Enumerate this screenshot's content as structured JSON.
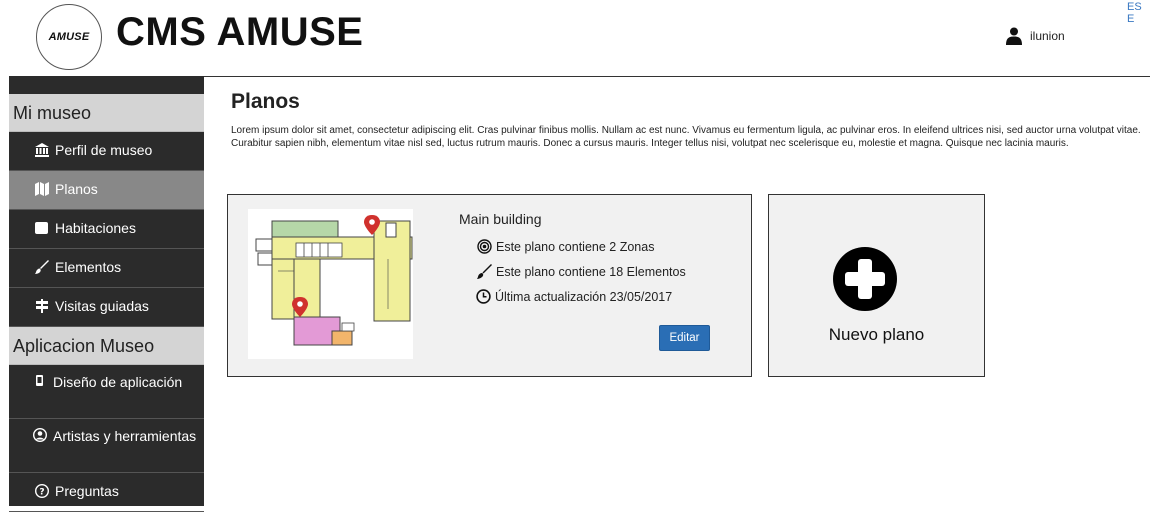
{
  "header": {
    "logo_text": "AMUSE",
    "brand": "CMS AMUSE",
    "lang": "ES E",
    "user_name": "ilunion"
  },
  "sidebar": {
    "sections": [
      {
        "title": "Mi museo",
        "items": [
          {
            "label": "Perfil de museo",
            "icon": "museum-icon",
            "active": false
          },
          {
            "label": "Planos",
            "icon": "map-icon",
            "active": true
          },
          {
            "label": "Habitaciones",
            "icon": "square-icon",
            "active": false
          },
          {
            "label": "Elementos",
            "icon": "brush-icon",
            "active": false
          },
          {
            "label": "Visitas guiadas",
            "icon": "signpost-icon",
            "active": false
          }
        ]
      },
      {
        "title": "Aplicacion Museo",
        "items": [
          {
            "label": "Diseño de aplicación",
            "icon": "phone-icon",
            "active": false
          },
          {
            "label": "Artistas y herramientas",
            "icon": "user-circle-icon",
            "active": false
          },
          {
            "label": "Preguntas",
            "icon": "question-circle-icon",
            "active": false
          }
        ]
      }
    ]
  },
  "main": {
    "title": "Planos",
    "description": "Lorem ipsum dolor sit amet, consectetur adipiscing elit. Cras pulvinar finibus mollis. Nullam ac est nunc. Vivamus eu fermentum ligula, ac pulvinar eros. In eleifend ultrices nisi, sed auctor urna volutpat vitae. Curabitur sapien nibh, elementum vitae nisl sed, luctus rutrum mauris. Donec a cursus mauris. Integer tellus nisi, volutpat nec scelerisque eu, molestie et magna. Quisque nec lacinia mauris.",
    "plan_card": {
      "name": "Main building",
      "zones": "Este plano contiene 2 Zonas",
      "elements": "Este plano contiene 18 Elementos",
      "updated": "Última actualización 23/05/2017",
      "edit_label": "Editar"
    },
    "new_plan_label": "Nuevo plano"
  },
  "colors": {
    "sidebar_bg": "#2b2b2b",
    "section_bg": "#d4d4d4",
    "active_item_bg": "#888888",
    "button_blue": "#2a6eb5",
    "link_blue": "#3a78c2"
  }
}
